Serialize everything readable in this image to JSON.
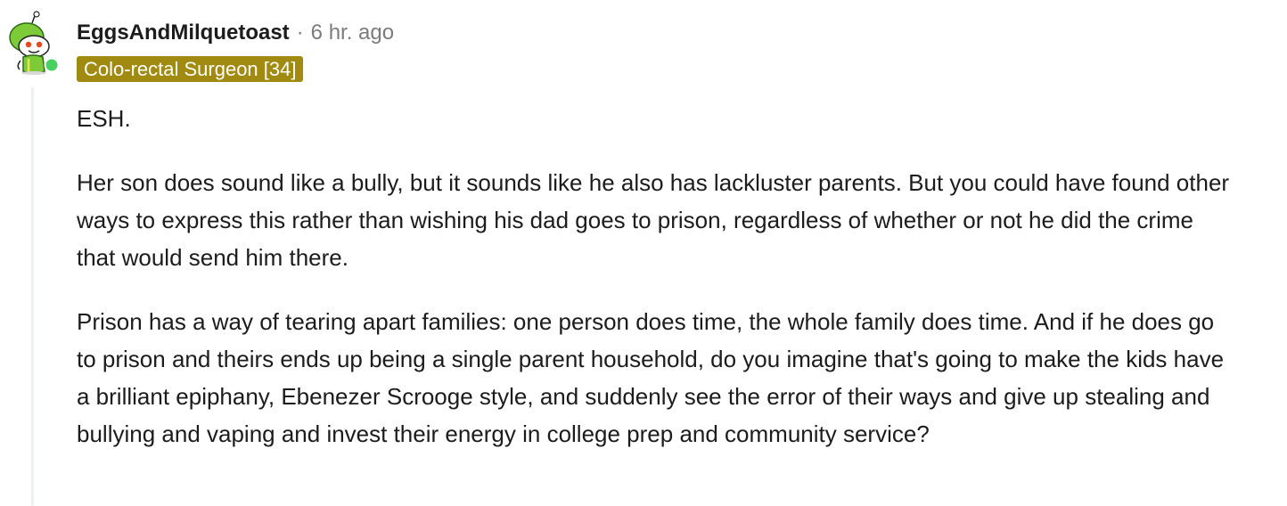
{
  "comment": {
    "username": "EggsAndMilquetoast",
    "separator": "·",
    "timestamp": "6 hr. ago",
    "flair": "Colo-rectal Surgeon [34]",
    "paragraphs": [
      "ESH.",
      "Her son does sound like a bully, but it sounds like he also has lackluster parents. But you could have found other ways to express this rather than wishing his dad goes to prison, regardless of whether or not he did the crime that would send him there.",
      "Prison has a way of tearing apart families: one person does time, the whole family does time. And if he does go to prison and theirs ends up being a single parent household, do you imagine that's going to make the kids have a brilliant epiphany, Ebenezer Scrooge style, and suddenly see the error of their ways and give up stealing and bullying and vaping and invest their energy in college prep and community service?"
    ]
  },
  "colors": {
    "flair_bg": "#a08a0f",
    "online_dot": "#46d160",
    "avatar_green": "#7ecb3a",
    "thread_line": "#edeff1"
  },
  "icons": {
    "avatar": "snoo-avatar-icon",
    "online": "online-status-icon"
  }
}
